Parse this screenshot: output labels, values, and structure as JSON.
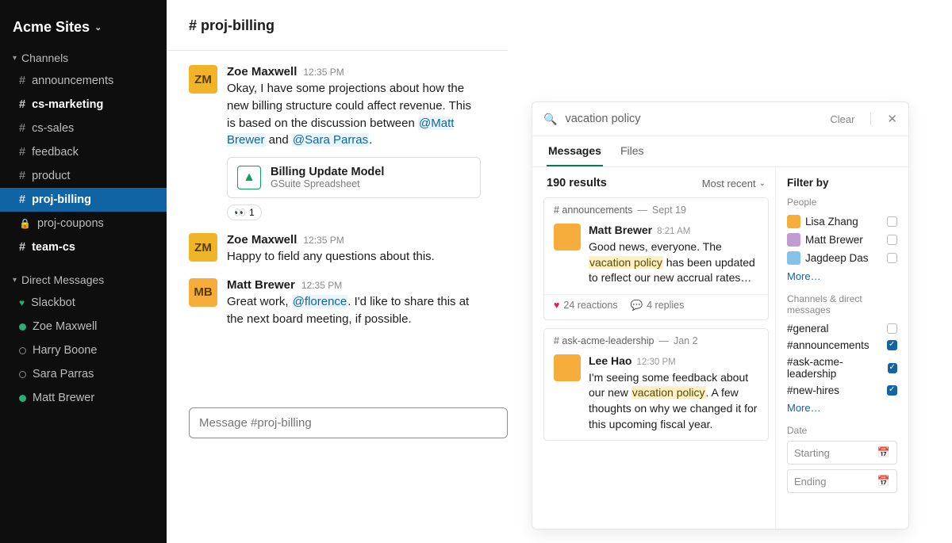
{
  "workspace": {
    "name": "Acme Sites"
  },
  "sections": {
    "channels_label": "Channels",
    "dms_label": "Direct Messages"
  },
  "channels": [
    {
      "name": "announcements",
      "prefix": "#",
      "bold": false,
      "selected": false
    },
    {
      "name": "cs-marketing",
      "prefix": "#",
      "bold": true,
      "selected": false
    },
    {
      "name": "cs-sales",
      "prefix": "#",
      "bold": false,
      "selected": false
    },
    {
      "name": "feedback",
      "prefix": "#",
      "bold": false,
      "selected": false
    },
    {
      "name": "product",
      "prefix": "#",
      "bold": false,
      "selected": false
    },
    {
      "name": "proj-billing",
      "prefix": "#",
      "bold": true,
      "selected": true
    },
    {
      "name": "proj-coupons",
      "prefix": "lock",
      "bold": false,
      "selected": false
    },
    {
      "name": "team-cs",
      "prefix": "#",
      "bold": true,
      "selected": false
    }
  ],
  "dms": [
    {
      "name": "Slackbot",
      "presence": "heart"
    },
    {
      "name": "Zoe Maxwell",
      "presence": "on"
    },
    {
      "name": "Harry Boone",
      "presence": "off"
    },
    {
      "name": "Sara Parras",
      "presence": "off"
    },
    {
      "name": "Matt Brewer",
      "presence": "on"
    }
  ],
  "channel_view": {
    "title": "# proj-billing",
    "composer_placeholder": "Message #proj-billing",
    "messages": [
      {
        "author": "Zoe Maxwell",
        "time": "12:35 PM",
        "text_before": "Okay, I have some projections about how the new billing structure could affect revenue. This is based on the discussion between ",
        "mention1": "@Matt Brewer",
        "text_mid": " and ",
        "mention2": "@Sara Parras",
        "text_after": ".",
        "attachment": {
          "title": "Billing Update Model",
          "subtitle": "GSuite Spreadsheet"
        },
        "reaction": {
          "emoji": "👀",
          "count": "1"
        }
      },
      {
        "author": "Zoe Maxwell",
        "time": "12:35 PM",
        "plain": "Happy to field any questions about this."
      },
      {
        "author": "Matt Brewer",
        "time": "12:35 PM",
        "text_before": "Great work, ",
        "mention1": "@florence",
        "text_after": ". I'd like to share this at the next board meeting, if possible."
      }
    ]
  },
  "search": {
    "query": "vacation policy",
    "clear_label": "Clear",
    "tabs": {
      "messages": "Messages",
      "files": "Files"
    },
    "results_count": "190 results",
    "sort_label": "Most recent",
    "results": [
      {
        "channel": "# announcements",
        "date": "Sept 19",
        "author": "Matt Brewer",
        "time": "8:21 AM",
        "pre": "Good news, everyone. The ",
        "hl": "vacation policy",
        "post": " has been updated to reflect our new accrual rates…",
        "reactions": "24 reactions",
        "replies": "4 replies"
      },
      {
        "channel": "# ask-acme-leadership",
        "date": "Jan 2",
        "author": "Lee Hao",
        "time": "12:30 PM",
        "pre": "I'm seeing some feedback about our new ",
        "hl": "vacation policy",
        "post": ". A few thoughts on why we changed it for this upcoming fiscal year."
      }
    ],
    "filters": {
      "title": "Filter by",
      "people_label": "People",
      "people": [
        {
          "name": "Lisa Zhang",
          "checked": false
        },
        {
          "name": "Matt Brewer",
          "checked": false
        },
        {
          "name": "Jagdeep Das",
          "checked": false
        }
      ],
      "more_label": "More…",
      "channels_label": "Channels & direct messages",
      "channels": [
        {
          "name": "#general",
          "checked": false
        },
        {
          "name": "#announcements",
          "checked": true
        },
        {
          "name": "#ask-acme-leadership",
          "checked": true
        },
        {
          "name": "#new-hires",
          "checked": true
        }
      ],
      "date_label": "Date",
      "date_start": "Starting",
      "date_end": "Ending"
    }
  }
}
